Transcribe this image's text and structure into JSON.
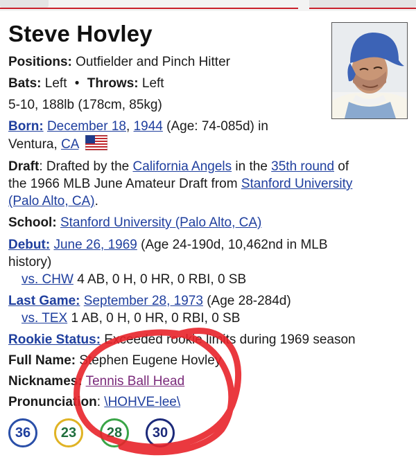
{
  "player": {
    "name": "Steve Hovley",
    "positions_label": "Positions:",
    "positions_value": "Outfielder and Pinch Hitter",
    "bats_label": "Bats:",
    "bats_value": "Left",
    "separator": "•",
    "throws_label": "Throws:",
    "throws_value": "Left",
    "size": "5-10, 188lb (178cm, 85kg)"
  },
  "born": {
    "label": "Born:",
    "date": "December 18",
    "comma": ",",
    "year": "1944",
    "age": "(Age: 74-085d) in",
    "city": "Ventura, ",
    "state": "CA",
    "flag_icon": "us-flag-icon"
  },
  "draft": {
    "label": "Draft",
    "line1_prefix": ": Drafted by the ",
    "team": "California Angels",
    "line1_mid": " in the ",
    "round": "35th round",
    "line1_end": " of",
    "line2_prefix": "the 1966 MLB June Amateur Draft from ",
    "school_part1": "Stanford University",
    "school_part2": "(Palo Alto, CA)",
    "line3_end": "."
  },
  "school": {
    "label": "School:",
    "value": "Stanford University (Palo Alto, CA)"
  },
  "debut": {
    "label": "Debut:",
    "date": "June 26, 1969",
    "detail1": " (Age 24-190d, 10,462nd in MLB",
    "detail2": "history)",
    "opp": "vs. CHW",
    "stats": " 4 AB, 0 H, 0 HR, 0 RBI, 0 SB"
  },
  "last_game": {
    "label": "Last Game:",
    "date": "September 28, 1973",
    "detail": " (Age 28-284d)",
    "opp": "vs. TEX",
    "stats": " 1 AB, 0 H, 0 HR, 0 RBI, 0 SB"
  },
  "rookie": {
    "label": "Rookie Status:",
    "value": " Exceeded rookie limits during 1969 season"
  },
  "full_name": {
    "label": "Full Name:",
    "value": " Stephen Eugene Hovley"
  },
  "nicknames": {
    "label": "Nicknames:",
    "value": "Tennis Ball Head"
  },
  "pronunciation": {
    "label": "Pronunciation",
    "prefix": ": ",
    "value": "\\HOHVE-lee\\",
    "suffix": ""
  },
  "uniform_numbers": [
    {
      "num": "36",
      "color": "#2a4fa8",
      "text": "#1f3f9e"
    },
    {
      "num": "23",
      "color": "#e0b324",
      "text": "#1f6e3c"
    },
    {
      "num": "28",
      "color": "#3aa547",
      "text": "#1f6e3c"
    },
    {
      "num": "30",
      "color": "#1c2a7a",
      "text": "#1c2a7a"
    }
  ],
  "annotation": {
    "color": "#e8232a"
  }
}
